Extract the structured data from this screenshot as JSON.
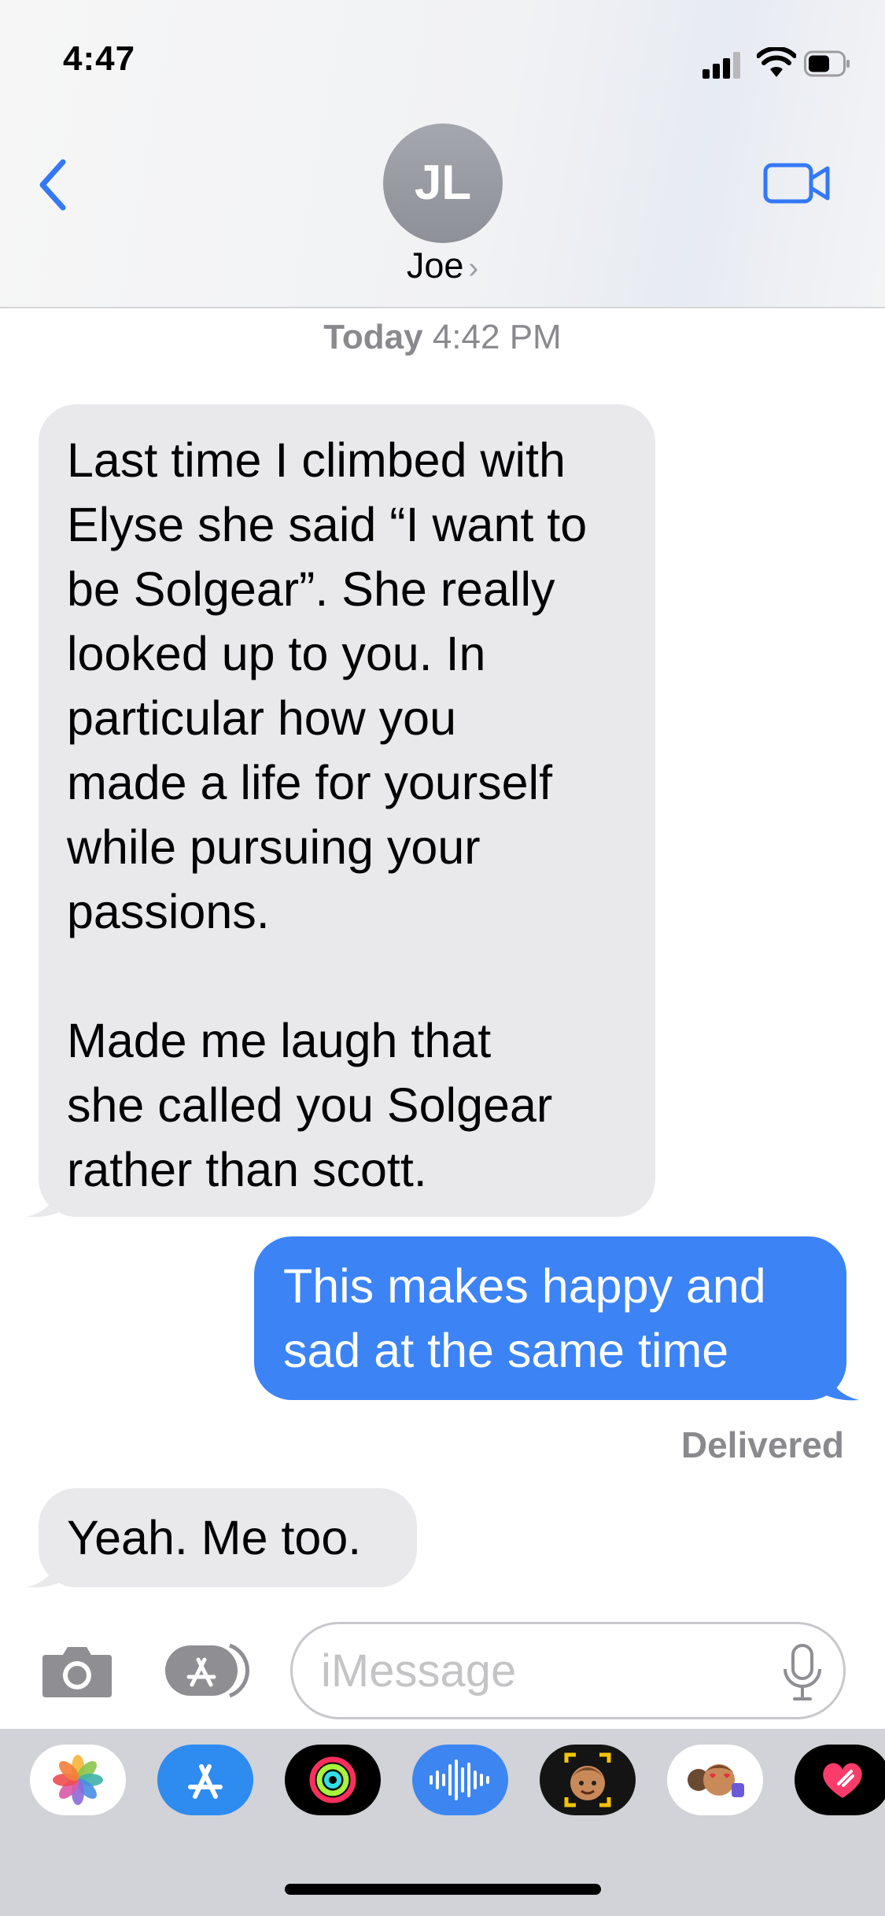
{
  "status_bar": {
    "time": "4:47"
  },
  "header": {
    "avatar_initials": "JL",
    "contact_name": "Joe",
    "contact_chevron": "›"
  },
  "timestamp": {
    "day": "Today",
    "time": "4:42 PM"
  },
  "messages": [
    {
      "direction": "incoming",
      "paragraphs": [
        "Last time I climbed with\nElyse she said “I want to\nbe Solgear”. She really\nlooked up to you. In\nparticular how you\nmade a life for yourself\nwhile pursuing your\npassions.",
        "Made me laugh that\nshe called you Solgear\nrather than scott."
      ]
    },
    {
      "direction": "outgoing",
      "text": "This makes happy and\nsad at the same time"
    },
    {
      "direction": "incoming",
      "text": "Yeah. Me too."
    }
  ],
  "delivery_status": "Delivered",
  "composer": {
    "placeholder": "iMessage"
  },
  "app_tray": [
    "photos-app",
    "app-store-app",
    "fitness-app",
    "audio-message-app",
    "memoji-app",
    "animoji-stickers-app",
    "digital-touch-app"
  ],
  "colors": {
    "outgoing_bubble": "#3c83f6",
    "incoming_bubble": "#e9e9eb",
    "link_blue": "#3478f6"
  }
}
